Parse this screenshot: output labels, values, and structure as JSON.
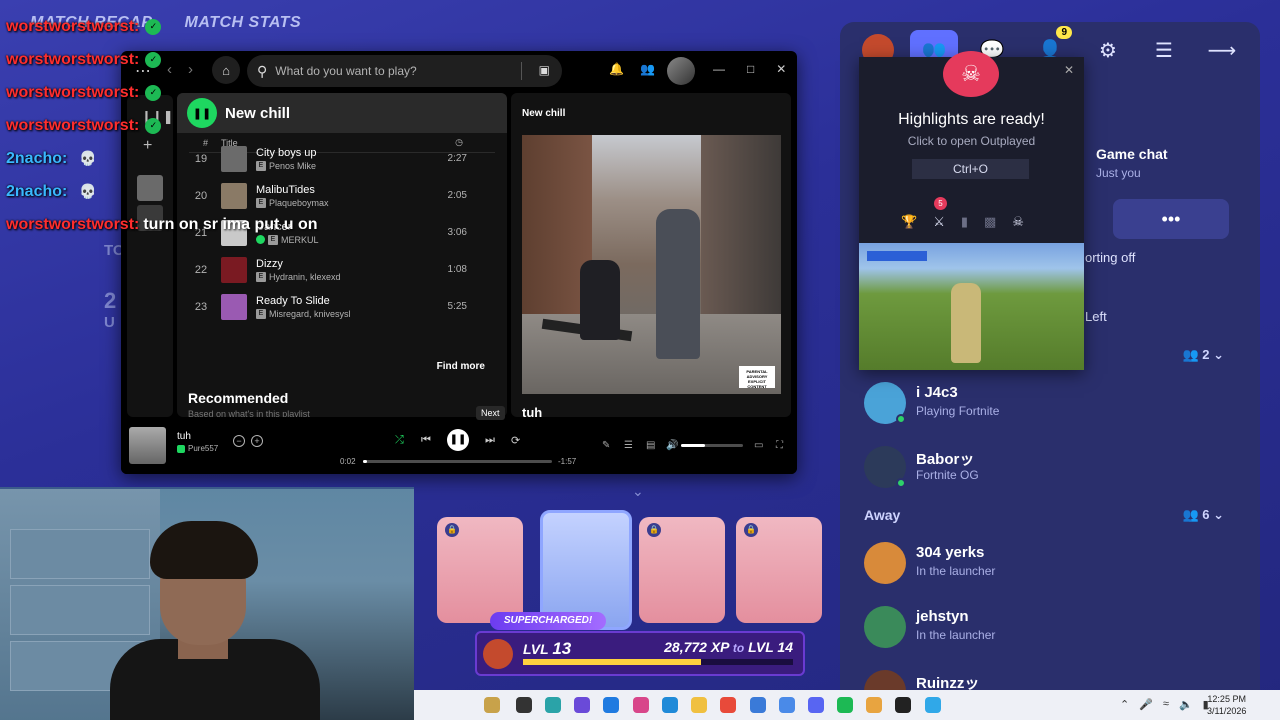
{
  "game": {
    "tabs": [
      "MATCH RECAP",
      "MATCH STATS"
    ],
    "partials": [
      "TO",
      "2",
      "U"
    ]
  },
  "chat": [
    {
      "user": "worstworstworst:",
      "user_color": "#ff2e2e",
      "message": "",
      "badge": true,
      "skull": false
    },
    {
      "user": "worstworstworst:",
      "user_color": "#ff2e2e",
      "message": "",
      "badge": true,
      "skull": false
    },
    {
      "user": "worstworstworst:",
      "user_color": "#ff2e2e",
      "message": "",
      "badge": true,
      "skull": false
    },
    {
      "user": "worstworstworst:",
      "user_color": "#ff2e2e",
      "message": "",
      "badge": true,
      "skull": false
    },
    {
      "user": "2nacho:",
      "user_color": "#39b8ff",
      "message": "",
      "badge": false,
      "skull": true
    },
    {
      "user": "2nacho:",
      "user_color": "#39b8ff",
      "message": "",
      "badge": false,
      "skull": true
    },
    {
      "user": "worstworstworst:",
      "user_color": "#ff2e2e",
      "message": "turn on sr ima put u on",
      "badge": false,
      "skull": false
    }
  ],
  "spotify": {
    "search_placeholder": "What do you want to play?",
    "playlist_title": "New chill",
    "col_title": "Title",
    "col_hash": "#",
    "tracks": [
      {
        "num": "19",
        "name": "City boys up",
        "artist": "Penos Mike",
        "duration": "2:27",
        "art_color": "#6b6b6b",
        "downloaded": false
      },
      {
        "num": "20",
        "name": "MalibuTides",
        "artist": "Plaqueboymax",
        "duration": "2:05",
        "art_color": "#8a7a66",
        "downloaded": false
      },
      {
        "num": "21",
        "name": "Cancer",
        "artist": "MERKUL",
        "duration": "3:06",
        "art_color": "#c9c9c9",
        "downloaded": true
      },
      {
        "num": "22",
        "name": "Dizzy",
        "artist": "Hydranin, klexexd",
        "duration": "1:08",
        "art_color": "#7a1a22",
        "downloaded": false
      },
      {
        "num": "23",
        "name": "Ready To Slide",
        "artist": "Misregard, knivesysl",
        "duration": "5:25",
        "art_color": "#9a5ab2",
        "downloaded": false
      }
    ],
    "find_more": "Find more",
    "recommended": "Recommended",
    "recommended_sub": "Based on what's in this playlist",
    "now_playing_label": "New chill",
    "advisory": "PARENTAL ADVISORY EXPLICIT CONTENT",
    "next_title": "tuh",
    "player": {
      "song": "tuh",
      "artist": "Pure557",
      "elapsed": "0:02",
      "remaining": "-1:57",
      "progress": 0.02,
      "volume": 0.38,
      "tooltip": "Next"
    }
  },
  "rewards": {
    "supercharged": "SUPERCHARGED!",
    "lvl_label": "LVL",
    "level": "13",
    "xp": "28,772 XP",
    "to_label": "to",
    "next_level_label": "LVL 14",
    "progress": 0.66
  },
  "social": {
    "notification_count": "9",
    "game_chat_title": "Game chat",
    "game_chat_sub": "Just you",
    "partial_texts": [
      "orting off",
      "Left"
    ],
    "online_count": "2",
    "away_label": "Away",
    "away_count": "6",
    "friends": [
      {
        "name": "i J4c3",
        "status": "Playing Fortnite",
        "online": true,
        "color": "#4aa3d8",
        "section": "online"
      },
      {
        "name": "Baborッ",
        "status": "Fortnite OG",
        "online": true,
        "color": "#2c3a5a",
        "section": "online"
      },
      {
        "name": "304 yerks",
        "status": "In the launcher",
        "online": false,
        "color": "#d88a3a",
        "section": "away"
      },
      {
        "name": "jehstyn",
        "status": "In the launcher",
        "online": false,
        "color": "#3a8a5a",
        "section": "away"
      },
      {
        "name": "Ruinzzッ",
        "status": "",
        "online": false,
        "color": "#6a3a2a",
        "section": "away"
      }
    ]
  },
  "outplayed": {
    "title": "Highlights are ready!",
    "subtitle": "Click to open Outplayed",
    "shortcut": "Ctrl+O",
    "badge": "5"
  },
  "taskbar": {
    "time": "12:25 PM",
    "date": "3/11/2026"
  }
}
